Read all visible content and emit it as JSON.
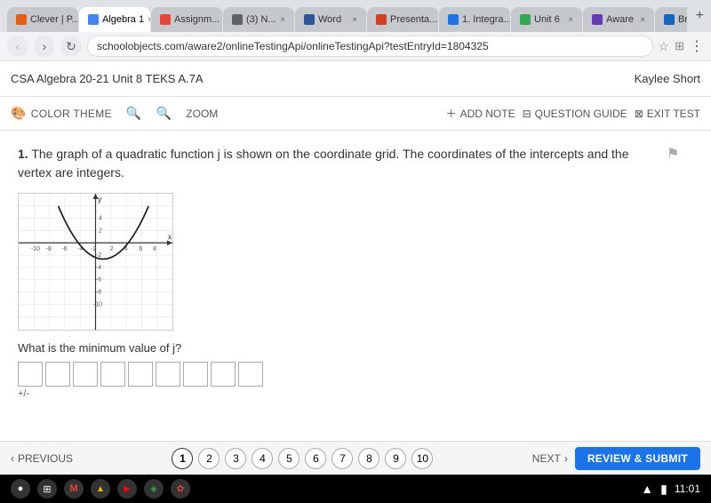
{
  "browser": {
    "tabs": [
      {
        "label": "Clever | P...",
        "favicon": "clever",
        "active": false
      },
      {
        "label": "Algebra 1",
        "favicon": "algebra",
        "active": true
      },
      {
        "label": "Assignm...",
        "favicon": "gmail",
        "active": false
      },
      {
        "label": "(3) N...",
        "favicon": "notif",
        "active": false
      },
      {
        "label": "Word",
        "favicon": "word",
        "active": false
      },
      {
        "label": "Presenta...",
        "favicon": "ppt",
        "active": false
      },
      {
        "label": "1. Integra...",
        "favicon": "integra",
        "active": false
      },
      {
        "label": "Unit 6",
        "favicon": "unit",
        "active": false
      },
      {
        "label": "Aware",
        "favicon": "aware",
        "active": false
      },
      {
        "label": "Brainly.c...",
        "favicon": "brainly",
        "active": false
      }
    ],
    "address": "schoolobjects.com/aware2/onlineTestingApi/onlineTestingApi?testEntryId=1804325"
  },
  "app": {
    "title": "CSA Algebra 20-21 Unit 8 TEKS A.7A",
    "user": "Kaylee Short"
  },
  "toolbar": {
    "color_theme_label": "COLOR THEME",
    "zoom_label": "ZOOM",
    "add_note_label": "ADD NOTE",
    "question_guide_label": "QUESTION GUIDE",
    "exit_test_label": "EXIT TEST"
  },
  "question": {
    "number": "1.",
    "text": "The graph of a quadratic function j is shown on the coordinate grid. The coordinates of the intercepts and the vertex are integers.",
    "sub_text": "What is the minimum value of j?"
  },
  "answer": {
    "cells": [
      "",
      "",
      "",
      "",
      "",
      "",
      "",
      "",
      ""
    ],
    "plus_minus": "+/-"
  },
  "pagination": {
    "prev_label": "PREVIOUS",
    "next_label": "NEXT",
    "pages": [
      "1",
      "2",
      "3",
      "4",
      "5",
      "6",
      "7",
      "8",
      "9",
      "10"
    ],
    "active_page": "1",
    "review_label": "REVIEW & SUBMIT"
  },
  "systembar": {
    "time": "11:01"
  }
}
